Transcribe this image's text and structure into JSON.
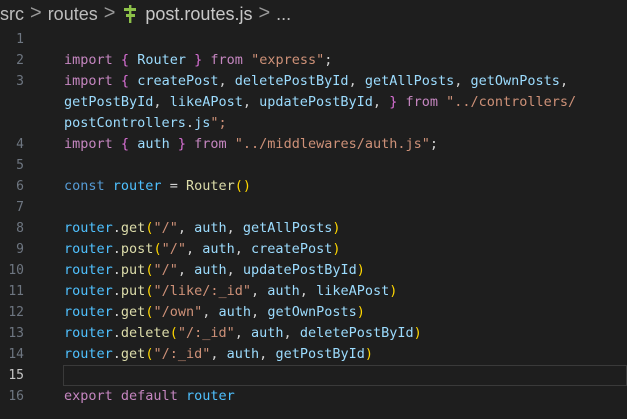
{
  "breadcrumb": {
    "items": [
      "src",
      "routes",
      "post.routes.js",
      "..."
    ],
    "separator": ">"
  },
  "editor": {
    "active_line": 15,
    "lines": [
      {
        "num": "1",
        "text": ""
      },
      {
        "num": "2",
        "text": "import { Router } from \"express\";"
      },
      {
        "num": "3",
        "text": "import { createPost, deletePostById, getAllPosts, getOwnPosts,"
      },
      {
        "num": "",
        "text": "getPostById, likeAPost, updatePostById, } from \"../controllers/"
      },
      {
        "num": "",
        "text": "postControllers.js\";"
      },
      {
        "num": "4",
        "text": "import { auth } from \"../middlewares/auth.js\";"
      },
      {
        "num": "5",
        "text": ""
      },
      {
        "num": "6",
        "text": "const router = Router()"
      },
      {
        "num": "7",
        "text": ""
      },
      {
        "num": "8",
        "text": "router.get(\"/\", auth, getAllPosts)"
      },
      {
        "num": "9",
        "text": "router.post(\"/\", auth, createPost)"
      },
      {
        "num": "10",
        "text": "router.put(\"/\", auth, updatePostById)"
      },
      {
        "num": "11",
        "text": "router.put(\"/like/:_id\", auth, likeAPost)"
      },
      {
        "num": "12",
        "text": "router.get(\"/own\", auth, getOwnPosts)"
      },
      {
        "num": "13",
        "text": "router.delete(\"/:_id\", auth, deletePostById)"
      },
      {
        "num": "14",
        "text": "router.get(\"/:_id\", auth, getPostById)"
      },
      {
        "num": "15",
        "text": ""
      },
      {
        "num": "16",
        "text": "export default router"
      }
    ]
  },
  "colors": {
    "background": "#1e1e1e",
    "keyword": "#c586c0",
    "storage": "#569cd6",
    "variable": "#9cdcfe",
    "function": "#dcdcaa",
    "string": "#ce9178",
    "class": "#4ec9b0"
  },
  "icons": {
    "file_icon": "routes-file-icon"
  }
}
